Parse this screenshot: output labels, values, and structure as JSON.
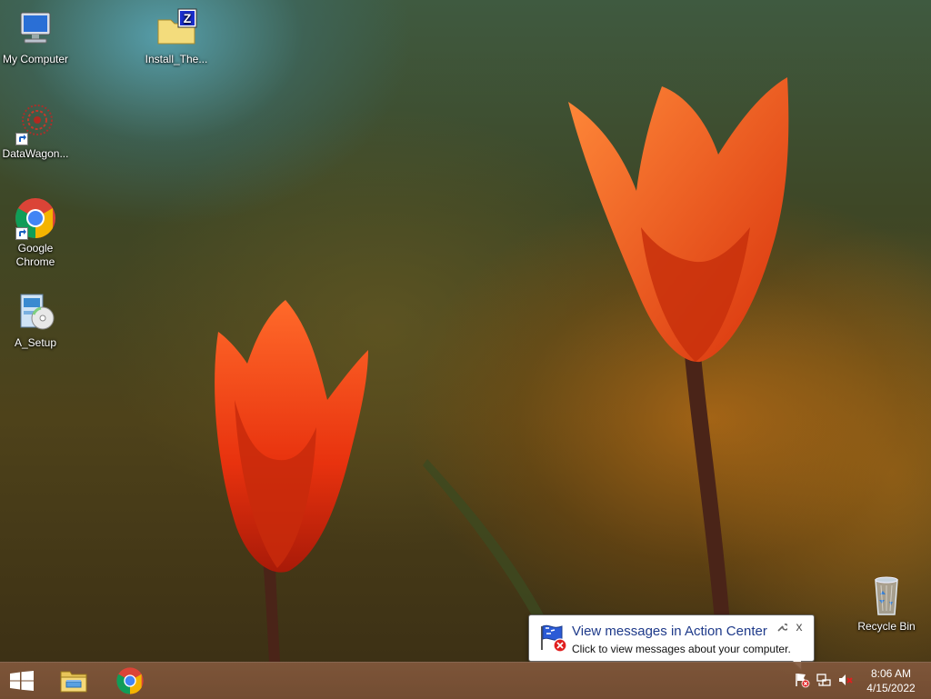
{
  "desktop": {
    "icons": [
      {
        "label": "My Computer",
        "icon": "computer-icon"
      },
      {
        "label": "Install_The...",
        "icon": "zip-folder-icon"
      },
      {
        "label": "DataWagon...",
        "icon": "datawagon-icon",
        "shortcut": true
      },
      {
        "label": "Google Chrome",
        "icon": "chrome-icon",
        "shortcut": true
      },
      {
        "label": "A_Setup",
        "icon": "setup-icon"
      },
      {
        "label": "Recycle Bin",
        "icon": "recycle-bin-icon"
      }
    ]
  },
  "taskbar": {
    "start_icon": "windows-start-icon",
    "pinned": [
      {
        "name": "File Explorer",
        "icon": "file-explorer-icon"
      },
      {
        "name": "Google Chrome",
        "icon": "chrome-icon"
      }
    ],
    "tray": [
      {
        "icon": "action-center-flag-icon"
      },
      {
        "icon": "network-icon"
      },
      {
        "icon": "volume-muted-icon"
      }
    ],
    "clock": {
      "time": "8:06 AM",
      "date": "4/15/2022"
    }
  },
  "notification": {
    "title": "View messages in Action Center",
    "text": "Click to view messages about your computer.",
    "close_glyph": "x",
    "icon": "action-center-flag-error-icon"
  },
  "colors": {
    "taskbar": "#7f5a40",
    "balloon_title": "#1e3a8a",
    "chrome_red": "#db4437",
    "chrome_green": "#0f9d58",
    "chrome_yellow": "#f4b400",
    "chrome_blue": "#4285f4"
  }
}
